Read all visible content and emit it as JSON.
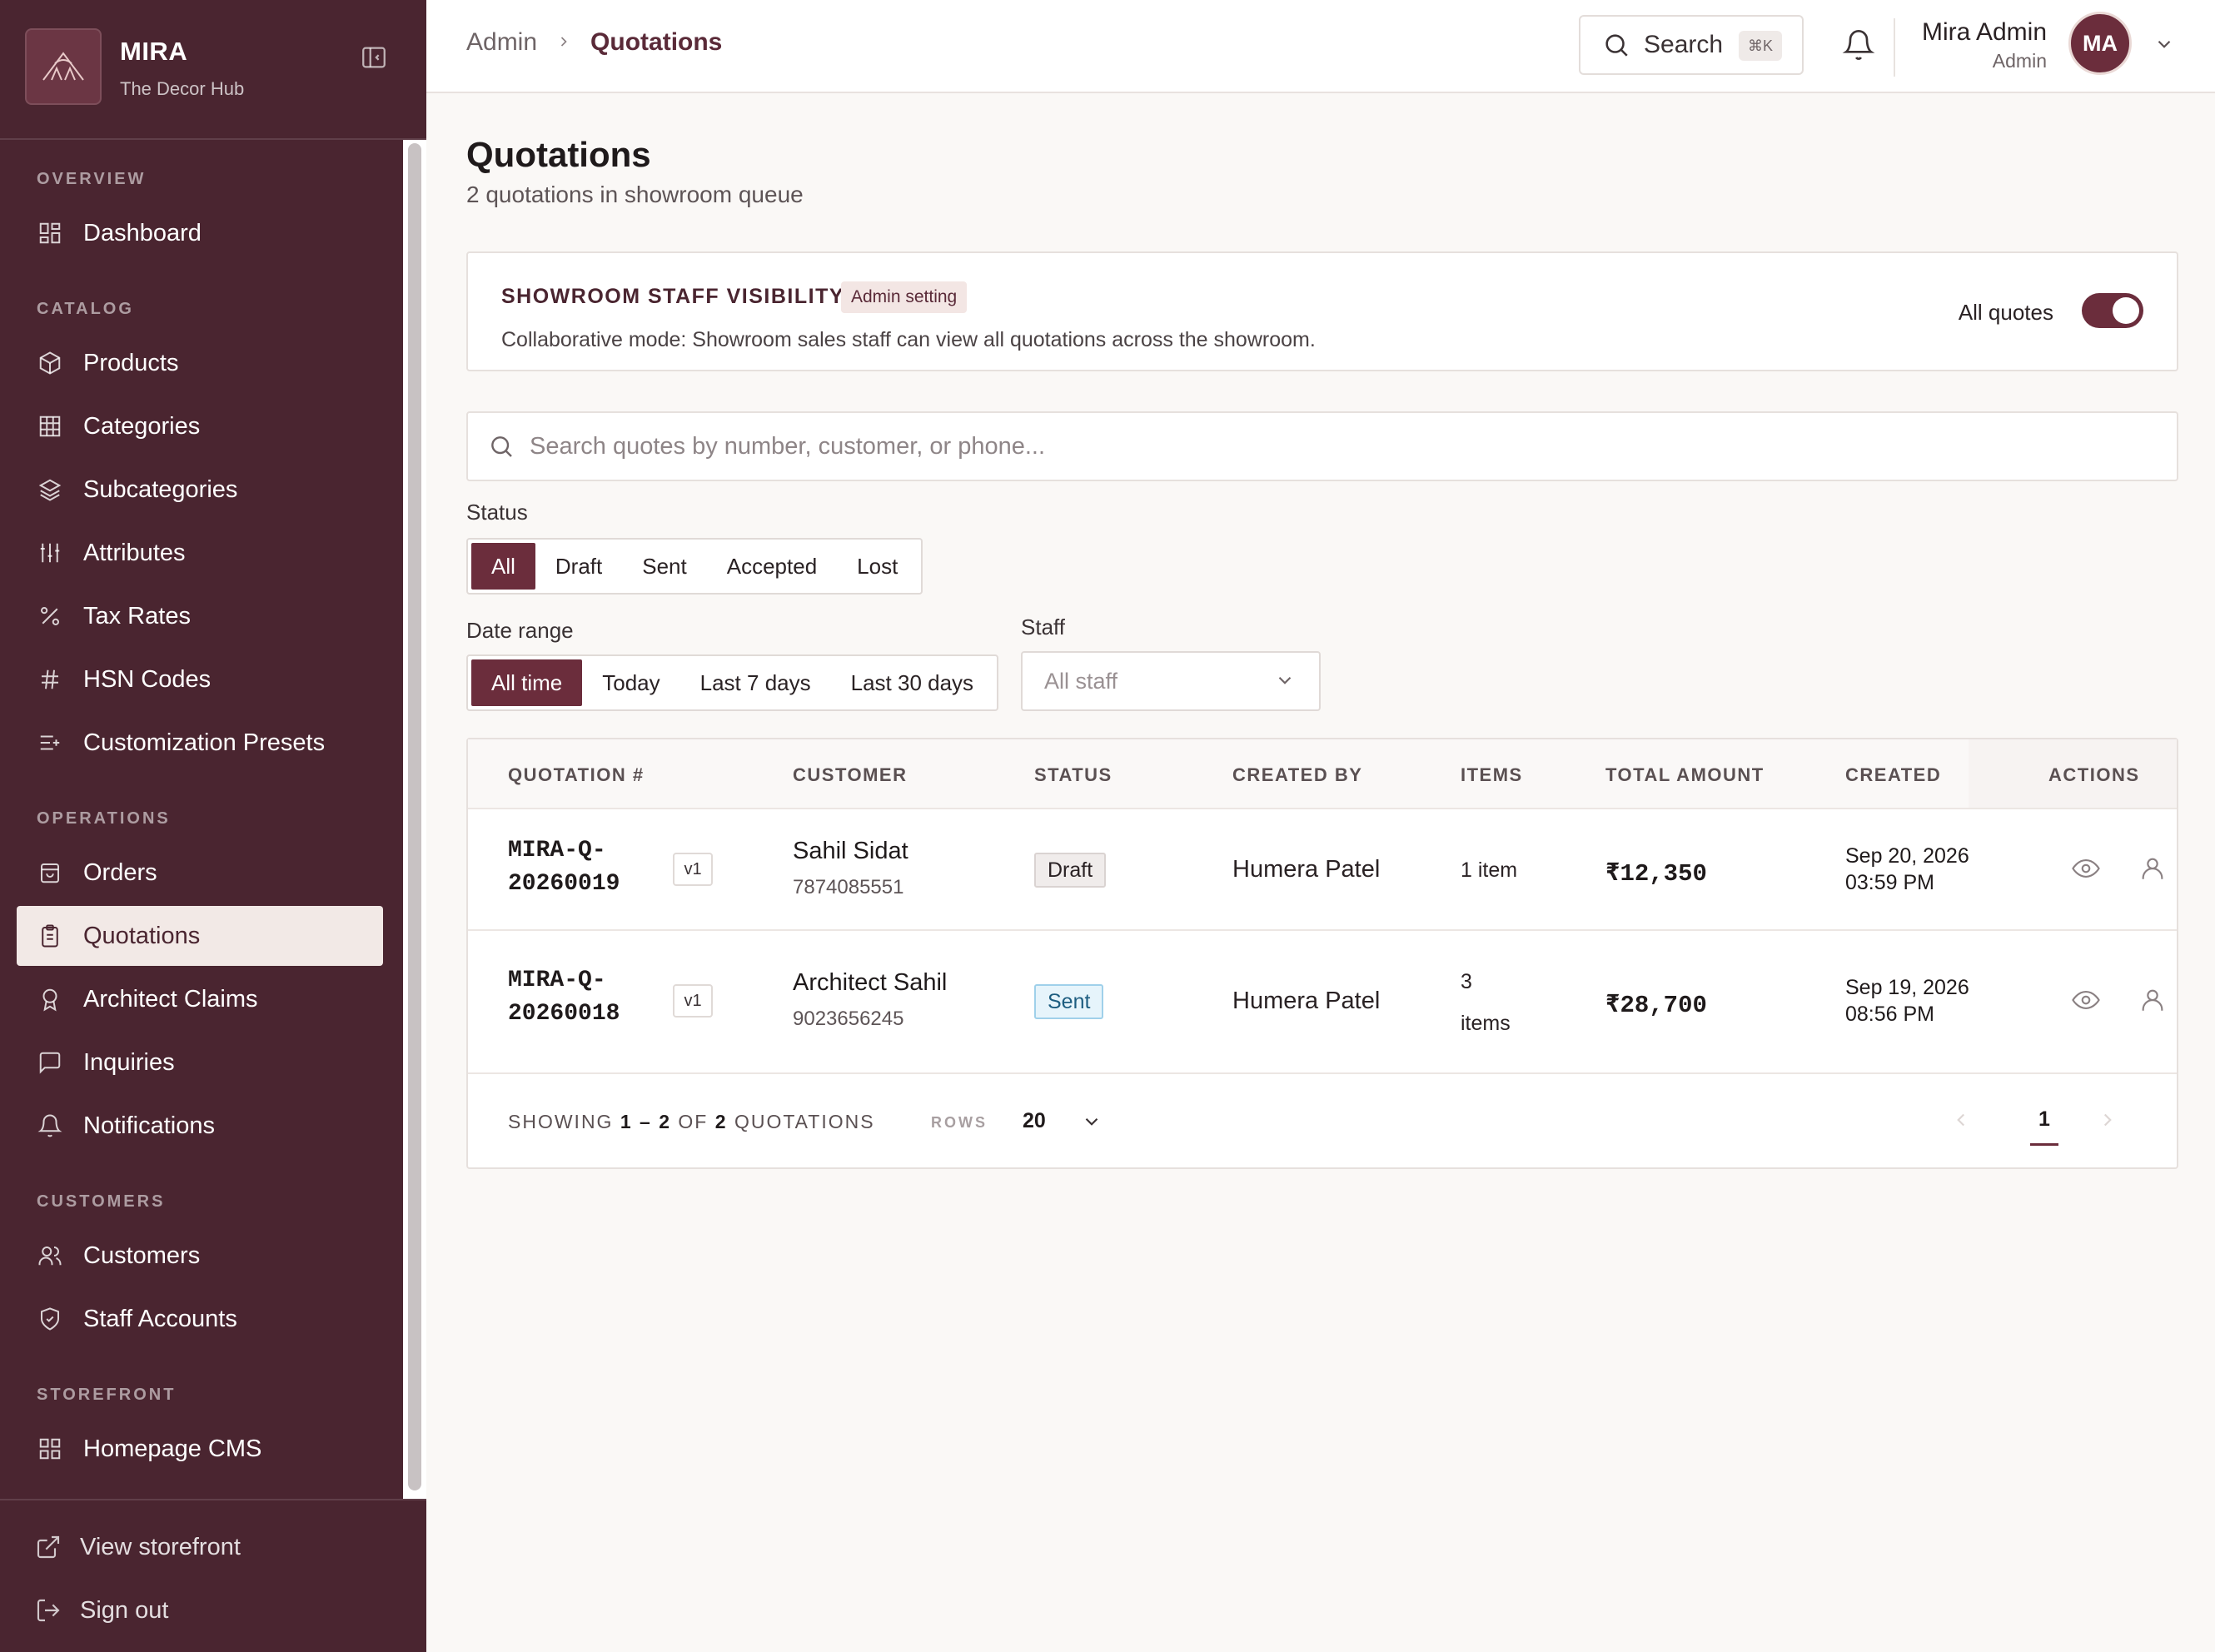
{
  "brand": {
    "name": "MIRA",
    "subtitle": "The Decor Hub"
  },
  "sidebar": {
    "sections": [
      {
        "label": "OVERVIEW",
        "items": [
          {
            "label": "Dashboard",
            "icon": "grid-icon"
          }
        ]
      },
      {
        "label": "CATALOG",
        "items": [
          {
            "label": "Products",
            "icon": "box-icon"
          },
          {
            "label": "Categories",
            "icon": "table-grid-icon"
          },
          {
            "label": "Subcategories",
            "icon": "layers-icon"
          },
          {
            "label": "Attributes",
            "icon": "sliders-icon"
          },
          {
            "label": "Tax Rates",
            "icon": "percent-icon"
          },
          {
            "label": "HSN Codes",
            "icon": "hash-icon"
          },
          {
            "label": "Customization Presets",
            "icon": "list-plus-icon"
          }
        ]
      },
      {
        "label": "OPERATIONS",
        "items": [
          {
            "label": "Orders",
            "icon": "shopping-bag-icon"
          },
          {
            "label": "Quotations",
            "icon": "clipboard-icon",
            "active": true
          },
          {
            "label": "Architect Claims",
            "icon": "award-icon"
          },
          {
            "label": "Inquiries",
            "icon": "message-square-icon"
          },
          {
            "label": "Notifications",
            "icon": "bell-icon"
          }
        ]
      },
      {
        "label": "CUSTOMERS",
        "items": [
          {
            "label": "Customers",
            "icon": "users-icon"
          },
          {
            "label": "Staff Accounts",
            "icon": "shield-icon"
          }
        ]
      },
      {
        "label": "STOREFRONT",
        "items": [
          {
            "label": "Homepage CMS",
            "icon": "grid-icon"
          }
        ]
      }
    ],
    "footer": {
      "view_storefront": "View storefront",
      "sign_out": "Sign out"
    }
  },
  "topbar": {
    "breadcrumb": [
      "Admin",
      "Quotations"
    ],
    "search_label": "Search",
    "search_shortcut": "⌘K",
    "user_name": "Mira Admin",
    "user_role": "Admin",
    "avatar_initials": "MA"
  },
  "page": {
    "title": "Quotations",
    "subtitle": "2 quotations in showroom queue"
  },
  "visibility": {
    "title": "SHOWROOM STAFF VISIBILITY",
    "badge": "Admin setting",
    "description": "Collaborative mode: Showroom sales staff can view all quotations across the showroom.",
    "toggle_label": "All quotes",
    "toggle_on": true
  },
  "search": {
    "placeholder": "Search quotes by number, customer, or phone..."
  },
  "filters": {
    "status_label": "Status",
    "status_options": [
      "All",
      "Draft",
      "Sent",
      "Accepted",
      "Lost"
    ],
    "status_selected": "All",
    "date_label": "Date range",
    "date_options": [
      "All time",
      "Today",
      "Last 7 days",
      "Last 30 days"
    ],
    "date_selected": "All time",
    "staff_label": "Staff",
    "staff_value": "All staff"
  },
  "table": {
    "columns": [
      "QUOTATION #",
      "CUSTOMER",
      "STATUS",
      "CREATED BY",
      "ITEMS",
      "TOTAL AMOUNT",
      "CREATED",
      "ACTIONS"
    ],
    "rows": [
      {
        "number_line1": "MIRA-Q-",
        "number_line2": "20260019",
        "version": "v1",
        "customer": "Sahil Sidat",
        "phone": "7874085551",
        "status": "Draft",
        "created_by": "Humera Patel",
        "items": "1 item",
        "total": "₹12,350",
        "date": "Sep 20, 2026",
        "time": "03:59 PM"
      },
      {
        "number_line1": "MIRA-Q-",
        "number_line2": "20260018",
        "version": "v1",
        "customer": "Architect Sahil",
        "phone": "9023656245",
        "status": "Sent",
        "created_by": "Humera Patel",
        "items_line1": "3",
        "items_line2": "items",
        "total": "₹28,700",
        "date": "Sep 19, 2026",
        "time": "08:56 PM"
      }
    ],
    "footer": {
      "showing_prefix": "SHOWING",
      "range_start": "1",
      "range_sep": "–",
      "range_end": "2",
      "of": "OF",
      "total": "2",
      "suffix": "QUOTATIONS",
      "rows_label": "ROWS",
      "rows_value": "20",
      "page": "1"
    }
  },
  "colors": {
    "sidebar_bg": "#4a2530",
    "accent": "#6b2d3c",
    "active_nav_bg": "#f2e9e6"
  }
}
